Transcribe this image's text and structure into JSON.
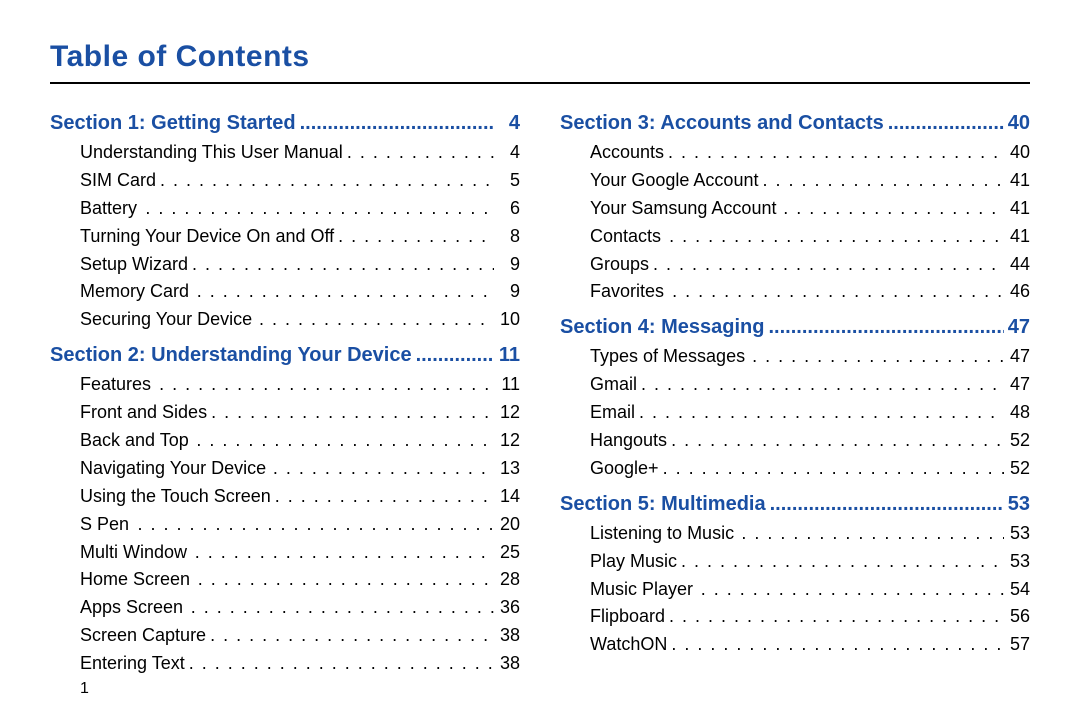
{
  "title": "Table of Contents",
  "page_number": "1",
  "columns": [
    [
      {
        "kind": "section",
        "label": "Section 1:  Getting Started",
        "page": "4"
      },
      {
        "kind": "item",
        "label": "Understanding This User Manual",
        "page": "4"
      },
      {
        "kind": "item",
        "label": "SIM Card",
        "page": "5"
      },
      {
        "kind": "item",
        "label": "Battery",
        "page": "6",
        "extra_space": true
      },
      {
        "kind": "item",
        "label": "Turning Your Device On and Off",
        "page": "8"
      },
      {
        "kind": "item",
        "label": "Setup Wizard",
        "page": "9"
      },
      {
        "kind": "item",
        "label": "Memory Card",
        "page": "9",
        "extra_space": true
      },
      {
        "kind": "item",
        "label": "Securing Your Device",
        "page": "10",
        "extra_space": true
      },
      {
        "kind": "section",
        "label": "Section 2:  Understanding Your Device",
        "page": "11"
      },
      {
        "kind": "item",
        "label": "Features",
        "page": "11",
        "extra_space": true
      },
      {
        "kind": "item",
        "label": "Front and Sides",
        "page": "12"
      },
      {
        "kind": "item",
        "label": "Back and Top",
        "page": "12",
        "extra_space": true
      },
      {
        "kind": "item",
        "label": "Navigating Your Device",
        "page": "13",
        "extra_space": true
      },
      {
        "kind": "item",
        "label": "Using the Touch Screen",
        "page": "14"
      },
      {
        "kind": "item",
        "label": "S Pen",
        "page": "20",
        "extra_space": true
      },
      {
        "kind": "item",
        "label": "Multi Window",
        "page": "25",
        "extra_space": true
      },
      {
        "kind": "item",
        "label": "Home Screen",
        "page": "28",
        "extra_space": true
      },
      {
        "kind": "item",
        "label": "Apps Screen",
        "page": "36",
        "extra_space": true
      },
      {
        "kind": "item",
        "label": "Screen Capture",
        "page": "38"
      },
      {
        "kind": "item",
        "label": "Entering Text",
        "page": "38"
      }
    ],
    [
      {
        "kind": "section",
        "label": "Section 3:  Accounts and Contacts",
        "page": "40"
      },
      {
        "kind": "item",
        "label": "Accounts",
        "page": "40"
      },
      {
        "kind": "item",
        "label": "Your Google Account",
        "page": "41"
      },
      {
        "kind": "item",
        "label": "Your Samsung Account",
        "page": "41",
        "extra_space": true
      },
      {
        "kind": "item",
        "label": "Contacts",
        "page": "41",
        "extra_space": true
      },
      {
        "kind": "item",
        "label": "Groups",
        "page": "44"
      },
      {
        "kind": "item",
        "label": "Favorites",
        "page": "46",
        "extra_space": true
      },
      {
        "kind": "section",
        "label": "Section 4:  Messaging",
        "page": "47"
      },
      {
        "kind": "item",
        "label": "Types of Messages",
        "page": "47",
        "extra_space": true
      },
      {
        "kind": "item",
        "label": "Gmail",
        "page": "47"
      },
      {
        "kind": "item",
        "label": "Email",
        "page": "48"
      },
      {
        "kind": "item",
        "label": "Hangouts",
        "page": "52"
      },
      {
        "kind": "item",
        "label": "Google+",
        "page": "52"
      },
      {
        "kind": "section",
        "label": "Section 5:  Multimedia",
        "page": "53"
      },
      {
        "kind": "item",
        "label": "Listening to Music",
        "page": "53",
        "extra_space": true
      },
      {
        "kind": "item",
        "label": "Play Music",
        "page": "53"
      },
      {
        "kind": "item",
        "label": "Music Player",
        "page": "54",
        "extra_space": true
      },
      {
        "kind": "item",
        "label": "Flipboard",
        "page": "56"
      },
      {
        "kind": "item",
        "label": "WatchON",
        "page": "57"
      }
    ]
  ]
}
